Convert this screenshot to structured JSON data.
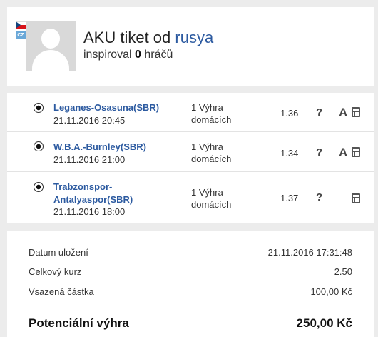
{
  "header": {
    "country_code": "CZ",
    "title_prefix": "AKU tiket od ",
    "author": "rusya",
    "inspired_prefix": "inspiroval ",
    "inspired_count": "0",
    "inspired_suffix": " hráčů"
  },
  "bets": [
    {
      "match": "Leganes-Osasuna(SBR)",
      "date": "21.11.2016 20:45",
      "tip": "1 Výhra domácích",
      "odd": "1.36",
      "help": "?",
      "analysis": "A"
    },
    {
      "match": "W.B.A.-Burnley(SBR)",
      "date": "21.11.2016 21:00",
      "tip": "1 Výhra domácích",
      "odd": "1.34",
      "help": "?",
      "analysis": "A"
    },
    {
      "match": "Trabzonspor-Antalyaspor(SBR)",
      "date": "21.11.2016 18:00",
      "tip": "1 Výhra domácích",
      "odd": "1.37",
      "help": "?"
    }
  ],
  "summary": {
    "saved_label": "Datum uložení",
    "saved_value": "21.11.2016 17:31:48",
    "total_odds_label": "Celkový kurz",
    "total_odds_value": "2.50",
    "stake_label": "Vsazená částka",
    "stake_value": "100,00 Kč",
    "potential_label": "Potenciální výhra",
    "potential_value": "250,00 Kč"
  }
}
